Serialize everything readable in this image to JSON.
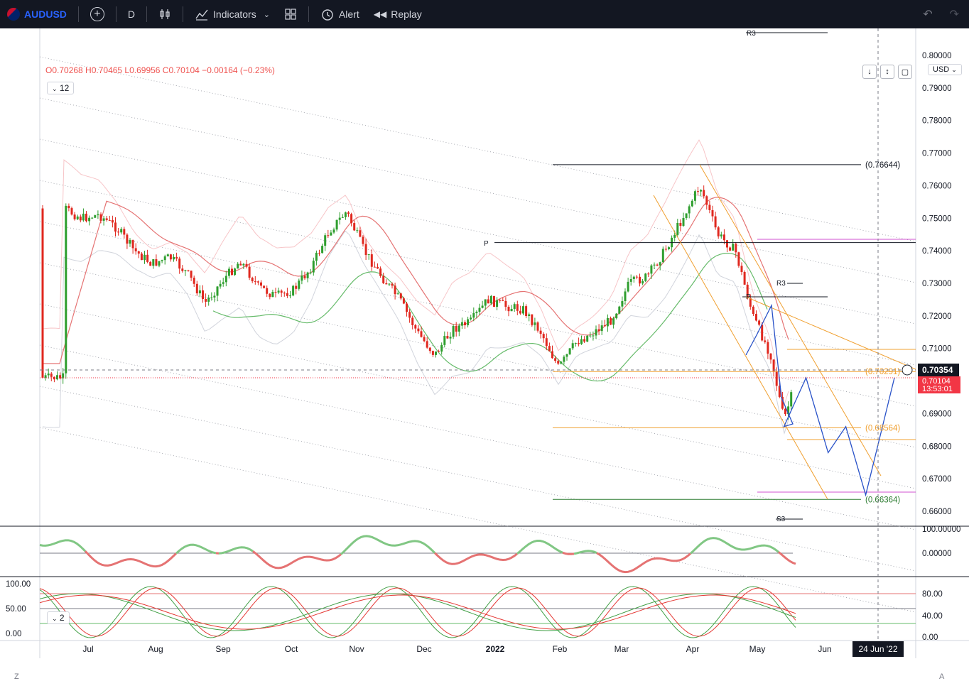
{
  "toolbar": {
    "symbol": "AUDUSD",
    "interval": "D",
    "indicators_label": "Indicators",
    "alert_label": "Alert",
    "replay_label": "Replay"
  },
  "legend": {
    "ohlc": "O0.70268 H0.70465 L0.69956 C0.70104 −0.00164 (−0.23%)",
    "indicator_count": "12",
    "pane3_count": "2"
  },
  "currency_selector": "USD",
  "colors": {
    "up": "#089981",
    "candle_up": "#2e9e2e",
    "down": "#e0281f",
    "pitchfork": "#f0a030",
    "magenta": "#d050d0",
    "forecast": "#2952c8"
  },
  "price_axis": {
    "ticks": [
      "0.80000",
      "0.79000",
      "0.78000",
      "0.77000",
      "0.76000",
      "0.75000",
      "0.74000",
      "0.73000",
      "0.72000",
      "0.71000",
      "0.70000",
      "0.69000",
      "0.68000",
      "0.67000",
      "0.66000"
    ],
    "current_price": "0.70354",
    "close_price": "0.70104",
    "countdown": "13:53:01"
  },
  "osc_axis": {
    "ticks": [
      "100.00000",
      "0.00000"
    ]
  },
  "stoch_axis": {
    "left_ticks": [
      "100.00",
      "50.00",
      "0.00"
    ],
    "right_ticks": [
      "80.00",
      "40.00",
      "0.00"
    ]
  },
  "time_axis": {
    "labels": [
      "Jul",
      "Aug",
      "Sep",
      "Oct",
      "Nov",
      "Dec",
      "2022",
      "Feb",
      "Mar",
      "Apr",
      "May",
      "Jun"
    ],
    "crosshair_label": "24 Jun '22"
  },
  "annotations": {
    "fib_levels": [
      "(0.76644)",
      "(0.70291)",
      "(0.68564)",
      "(0.66364)"
    ],
    "pivot_p": "P",
    "pivot_r3": "R3",
    "pivot_s3": "S3"
  },
  "chart_data": {
    "type": "candlestick",
    "symbol": "AUDUSD",
    "interval": "D",
    "x_range": [
      "2021-06",
      "2022-06"
    ],
    "ylim": [
      0.655,
      0.805
    ],
    "close_series": [
      {
        "x": "2021-06-20",
        "y": 0.753
      },
      {
        "x": "2021-06-28",
        "y": 0.75
      },
      {
        "x": "2021-07-06",
        "y": 0.751
      },
      {
        "x": "2021-07-14",
        "y": 0.747
      },
      {
        "x": "2021-07-22",
        "y": 0.74
      },
      {
        "x": "2021-07-30",
        "y": 0.736
      },
      {
        "x": "2021-08-07",
        "y": 0.738
      },
      {
        "x": "2021-08-15",
        "y": 0.733
      },
      {
        "x": "2021-08-23",
        "y": 0.724
      },
      {
        "x": "2021-08-31",
        "y": 0.731
      },
      {
        "x": "2021-09-08",
        "y": 0.737
      },
      {
        "x": "2021-09-16",
        "y": 0.729
      },
      {
        "x": "2021-09-24",
        "y": 0.726
      },
      {
        "x": "2021-10-02",
        "y": 0.728
      },
      {
        "x": "2021-10-10",
        "y": 0.735
      },
      {
        "x": "2021-10-18",
        "y": 0.746
      },
      {
        "x": "2021-10-26",
        "y": 0.752
      },
      {
        "x": "2021-11-03",
        "y": 0.74
      },
      {
        "x": "2021-11-11",
        "y": 0.732
      },
      {
        "x": "2021-11-19",
        "y": 0.725
      },
      {
        "x": "2021-11-27",
        "y": 0.715
      },
      {
        "x": "2021-12-05",
        "y": 0.708
      },
      {
        "x": "2021-12-13",
        "y": 0.716
      },
      {
        "x": "2021-12-21",
        "y": 0.718
      },
      {
        "x": "2021-12-29",
        "y": 0.725
      },
      {
        "x": "2022-01-06",
        "y": 0.723
      },
      {
        "x": "2022-01-14",
        "y": 0.722
      },
      {
        "x": "2022-01-22",
        "y": 0.715
      },
      {
        "x": "2022-01-30",
        "y": 0.704
      },
      {
        "x": "2022-02-07",
        "y": 0.712
      },
      {
        "x": "2022-02-15",
        "y": 0.715
      },
      {
        "x": "2022-02-23",
        "y": 0.719
      },
      {
        "x": "2022-03-03",
        "y": 0.73
      },
      {
        "x": "2022-03-11",
        "y": 0.732
      },
      {
        "x": "2022-03-19",
        "y": 0.74
      },
      {
        "x": "2022-03-27",
        "y": 0.75
      },
      {
        "x": "2022-04-04",
        "y": 0.76
      },
      {
        "x": "2022-04-12",
        "y": 0.745
      },
      {
        "x": "2022-04-20",
        "y": 0.74
      },
      {
        "x": "2022-04-28",
        "y": 0.72
      },
      {
        "x": "2022-05-06",
        "y": 0.708
      },
      {
        "x": "2022-05-12",
        "y": 0.688
      },
      {
        "x": "2022-05-18",
        "y": 0.701
      }
    ],
    "forecast_path": [
      {
        "x": "2022-05-12",
        "y": 0.686
      },
      {
        "x": "2022-05-22",
        "y": 0.701
      },
      {
        "x": "2022-06-01",
        "y": 0.678
      },
      {
        "x": "2022-06-09",
        "y": 0.686
      },
      {
        "x": "2022-06-18",
        "y": 0.665
      },
      {
        "x": "2022-07-01",
        "y": 0.701
      }
    ],
    "horizontal_levels": [
      {
        "label": "(0.76644)",
        "y": 0.76644
      },
      {
        "label": "P",
        "y": 0.7425
      },
      {
        "label": "(0.70291)",
        "y": 0.70291
      },
      {
        "label": "(0.68564)",
        "y": 0.68564
      },
      {
        "label": "(0.66364)",
        "y": 0.66364
      }
    ],
    "x_ticks": [
      "Jul",
      "Aug",
      "Sep",
      "Oct",
      "Nov",
      "Dec",
      "2022",
      "Feb",
      "Mar",
      "Apr",
      "May",
      "Jun"
    ],
    "y_ticks": [
      "0.80000",
      "0.79000",
      "0.78000",
      "0.77000",
      "0.76000",
      "0.75000",
      "0.74000",
      "0.73000",
      "0.72000",
      "0.71000",
      "0.70000",
      "0.69000",
      "0.68000",
      "0.67000",
      "0.66000"
    ],
    "grid": false
  }
}
